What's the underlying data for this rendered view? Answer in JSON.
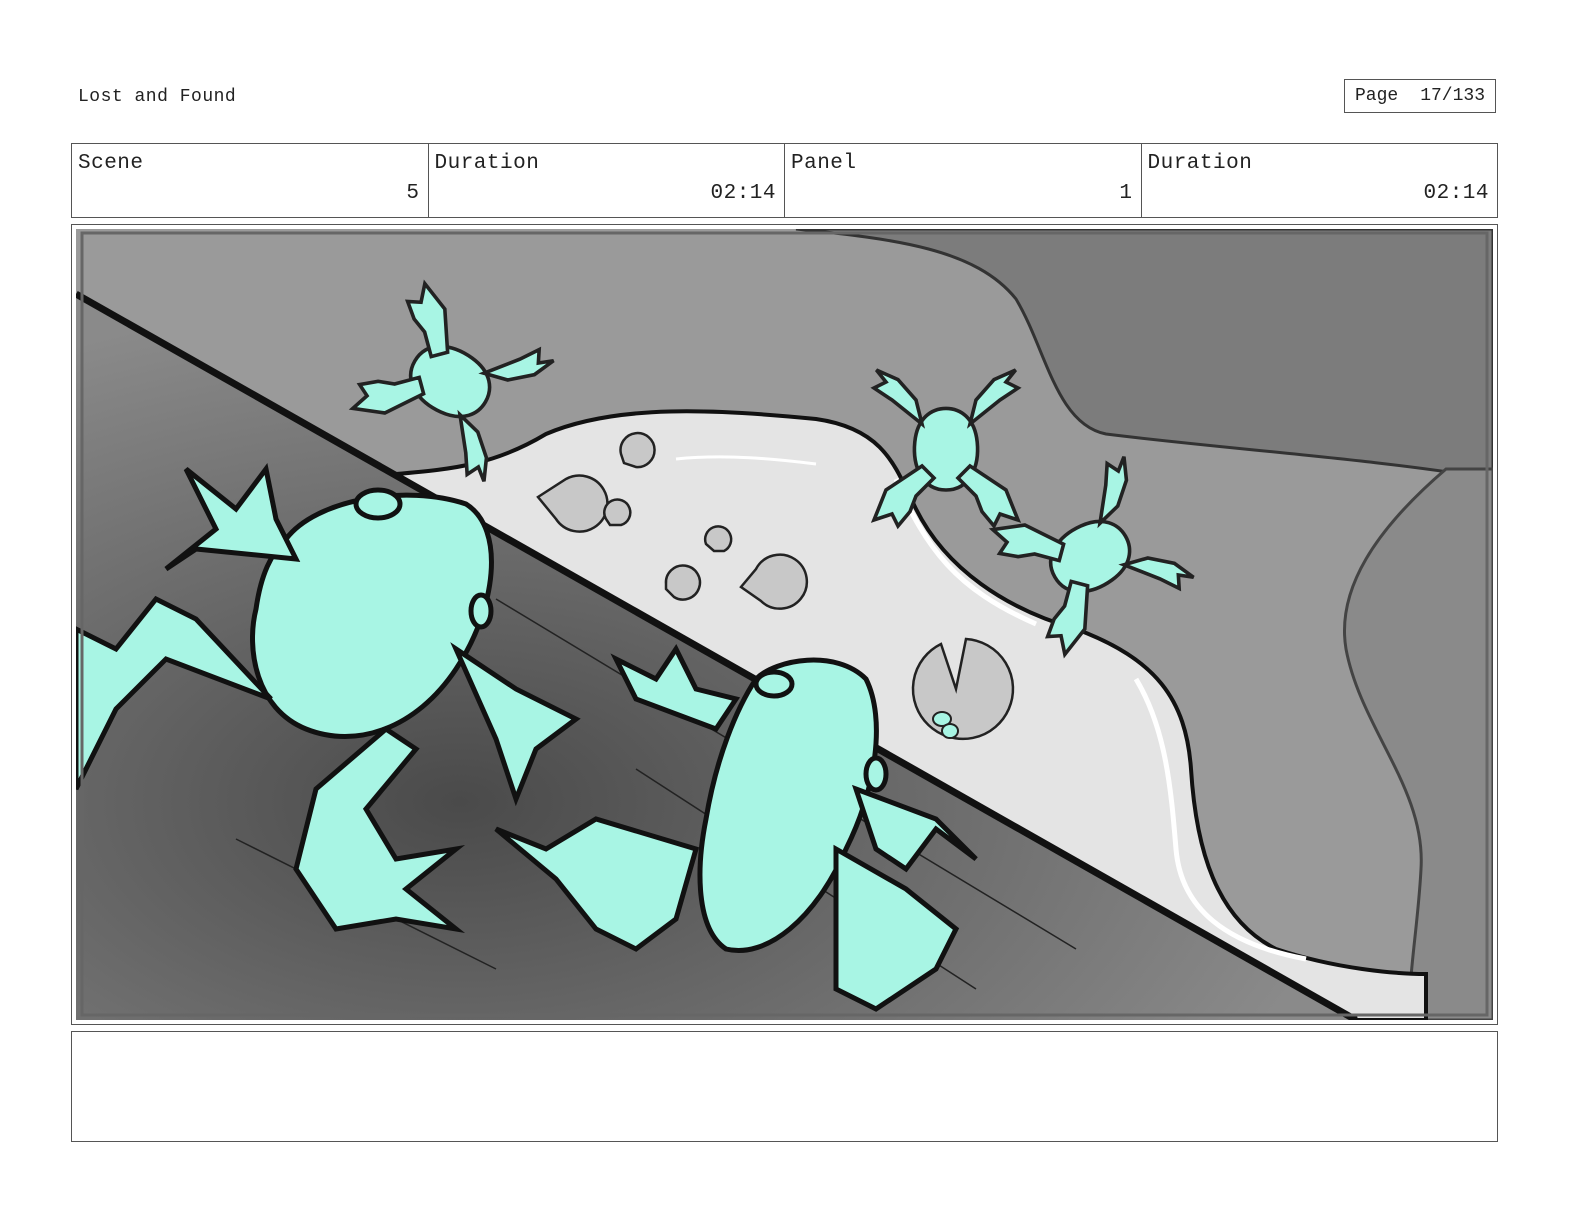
{
  "header": {
    "title": "Lost and Found",
    "page_label": "Page",
    "page_value": "17/133"
  },
  "info": {
    "scene_label": "Scene",
    "scene_value": "5",
    "duration1_label": "Duration",
    "duration1_value": "02:14",
    "panel_label": "Panel",
    "panel_value": "1",
    "duration2_label": "Duration",
    "duration2_value": "02:14"
  },
  "panel": {
    "frog_color": "#a8f5e4",
    "water_color": "#e4e4e4",
    "ground_color": "#999999",
    "dark_color": "#7a7a7a"
  },
  "notes": {
    "text": ""
  }
}
